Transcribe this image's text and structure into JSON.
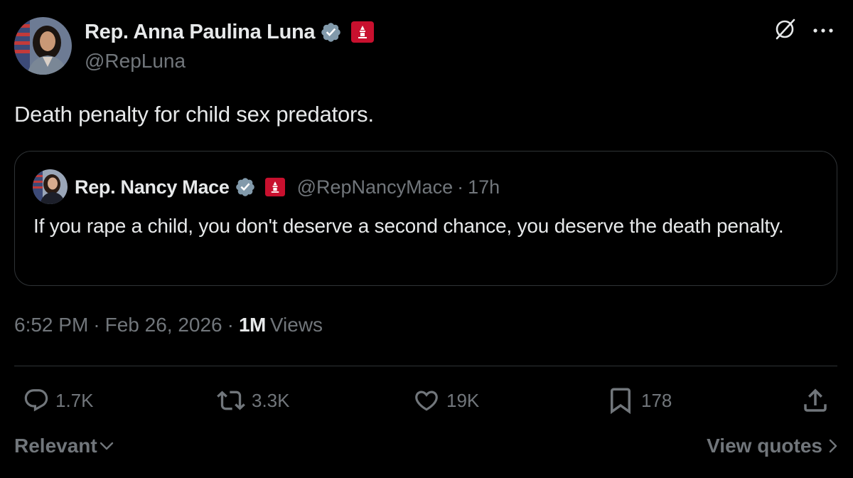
{
  "author": {
    "display_name": "Rep. Anna Paulina Luna",
    "handle": "@RepLuna"
  },
  "tweet": {
    "text": "Death penalty for child sex predators."
  },
  "quoted": {
    "display_name": "Rep. Nancy Mace",
    "handle": "@RepNancyMace",
    "separator": "·",
    "time": "17h",
    "text": "If you rape a child, you don't deserve a second chance, you deserve the death penalty."
  },
  "meta": {
    "time": "6:52 PM",
    "separator": "·",
    "date": "Feb 26, 2026",
    "views_count": "1M",
    "views_label": "Views"
  },
  "actions": {
    "replies": "1.7K",
    "reposts": "3.3K",
    "likes": "19K",
    "bookmarks": "178"
  },
  "footer": {
    "sort_label": "Relevant",
    "view_quotes": "View quotes"
  },
  "icons": [
    "grok-icon",
    "more-icon",
    "verified-icon",
    "government-badge-icon",
    "reply-icon",
    "repost-icon",
    "like-icon",
    "bookmark-icon",
    "share-icon",
    "chevron-down-icon",
    "chevron-right-icon"
  ],
  "colors": {
    "background": "#000000",
    "text_primary": "#e7e9ea",
    "text_secondary": "#71767b",
    "border": "#2f3336",
    "verified_badge": "#829aab",
    "gov_badge": "#c8102e"
  }
}
